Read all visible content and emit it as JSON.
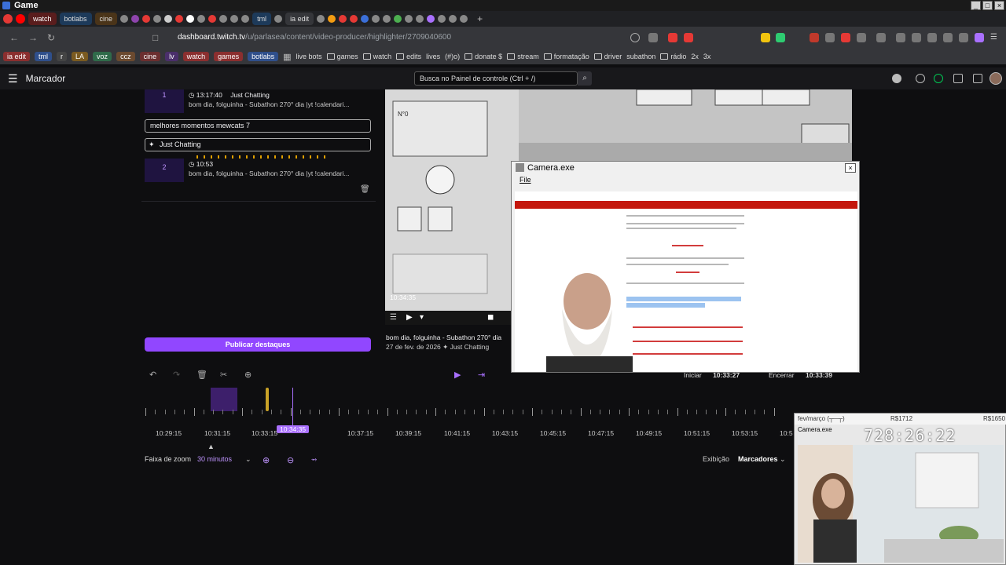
{
  "window": {
    "title": "Game"
  },
  "tabs": [
    "watch",
    "botlabs",
    "cine",
    "tml",
    "ia edit"
  ],
  "address": {
    "host": "dashboard.twitch.tv",
    "path": "/u/parlasea/content/video-producer/highlighter/2709040600"
  },
  "bookmarks": {
    "chips": [
      "ia edit",
      "tml",
      "r",
      "LA",
      "voz",
      "ccz",
      "cine",
      "lv",
      "watch",
      "games",
      "botlabs"
    ],
    "items": [
      "live bots",
      "games",
      "watch",
      "edits",
      "lives",
      "(#)o)",
      "donate $",
      "stream",
      "formatação",
      "driver",
      "subathon",
      "rádio",
      "2x",
      "3x"
    ]
  },
  "twitch": {
    "page_title": "Marcador",
    "search_placeholder": "Busca no Painel de controle (Ctrl + /)"
  },
  "clips": [
    {
      "num": "1",
      "time": "13:17:40",
      "category": "Just Chatting",
      "title": "bom dia, folguinha - Subathon 270° dia |yt !calendari..."
    },
    {
      "num": "2",
      "time": "10:53",
      "title": "bom dia, folguinha - Subathon 270° dia |yt !calendari..."
    }
  ],
  "highlight_title_value": "melhores momentos mewcats 7",
  "highlight_category_value": "Just Chatting",
  "publish_label": "Publicar destaques",
  "video": {
    "timestamp": "10:34:35",
    "caption": "bom dia, folguinha - Subathon 270° dia",
    "date_line": "27 de fev. de 2026",
    "category": "Just Chatting"
  },
  "camera_window": {
    "title": "Camera.exe",
    "menu": "File"
  },
  "range": {
    "start_label": "Iniciar",
    "start_time": "10:33:27",
    "end_label": "Encerrar",
    "end_time": "10:33:39"
  },
  "timeline": {
    "labels": [
      "10:29:15",
      "10:31:15",
      "10:33:15",
      "10:37:15",
      "10:39:15",
      "10:41:15",
      "10:43:15",
      "10:45:15",
      "10:47:15",
      "10:49:15",
      "10:51:15",
      "10:53:15",
      "10:5"
    ],
    "playhead_label": "10:34:35"
  },
  "zoom": {
    "label": "Faixa de zoom",
    "value": "30 minutos",
    "display_label": "Exibição",
    "markers_label": "Marcadores"
  },
  "stream_overlay": {
    "top_left": "fev/março (┬─┬)",
    "top_mid": "R$1712",
    "top_right": "R$1650",
    "cam_label": "Camera.exe",
    "counter": "728:26:22"
  }
}
